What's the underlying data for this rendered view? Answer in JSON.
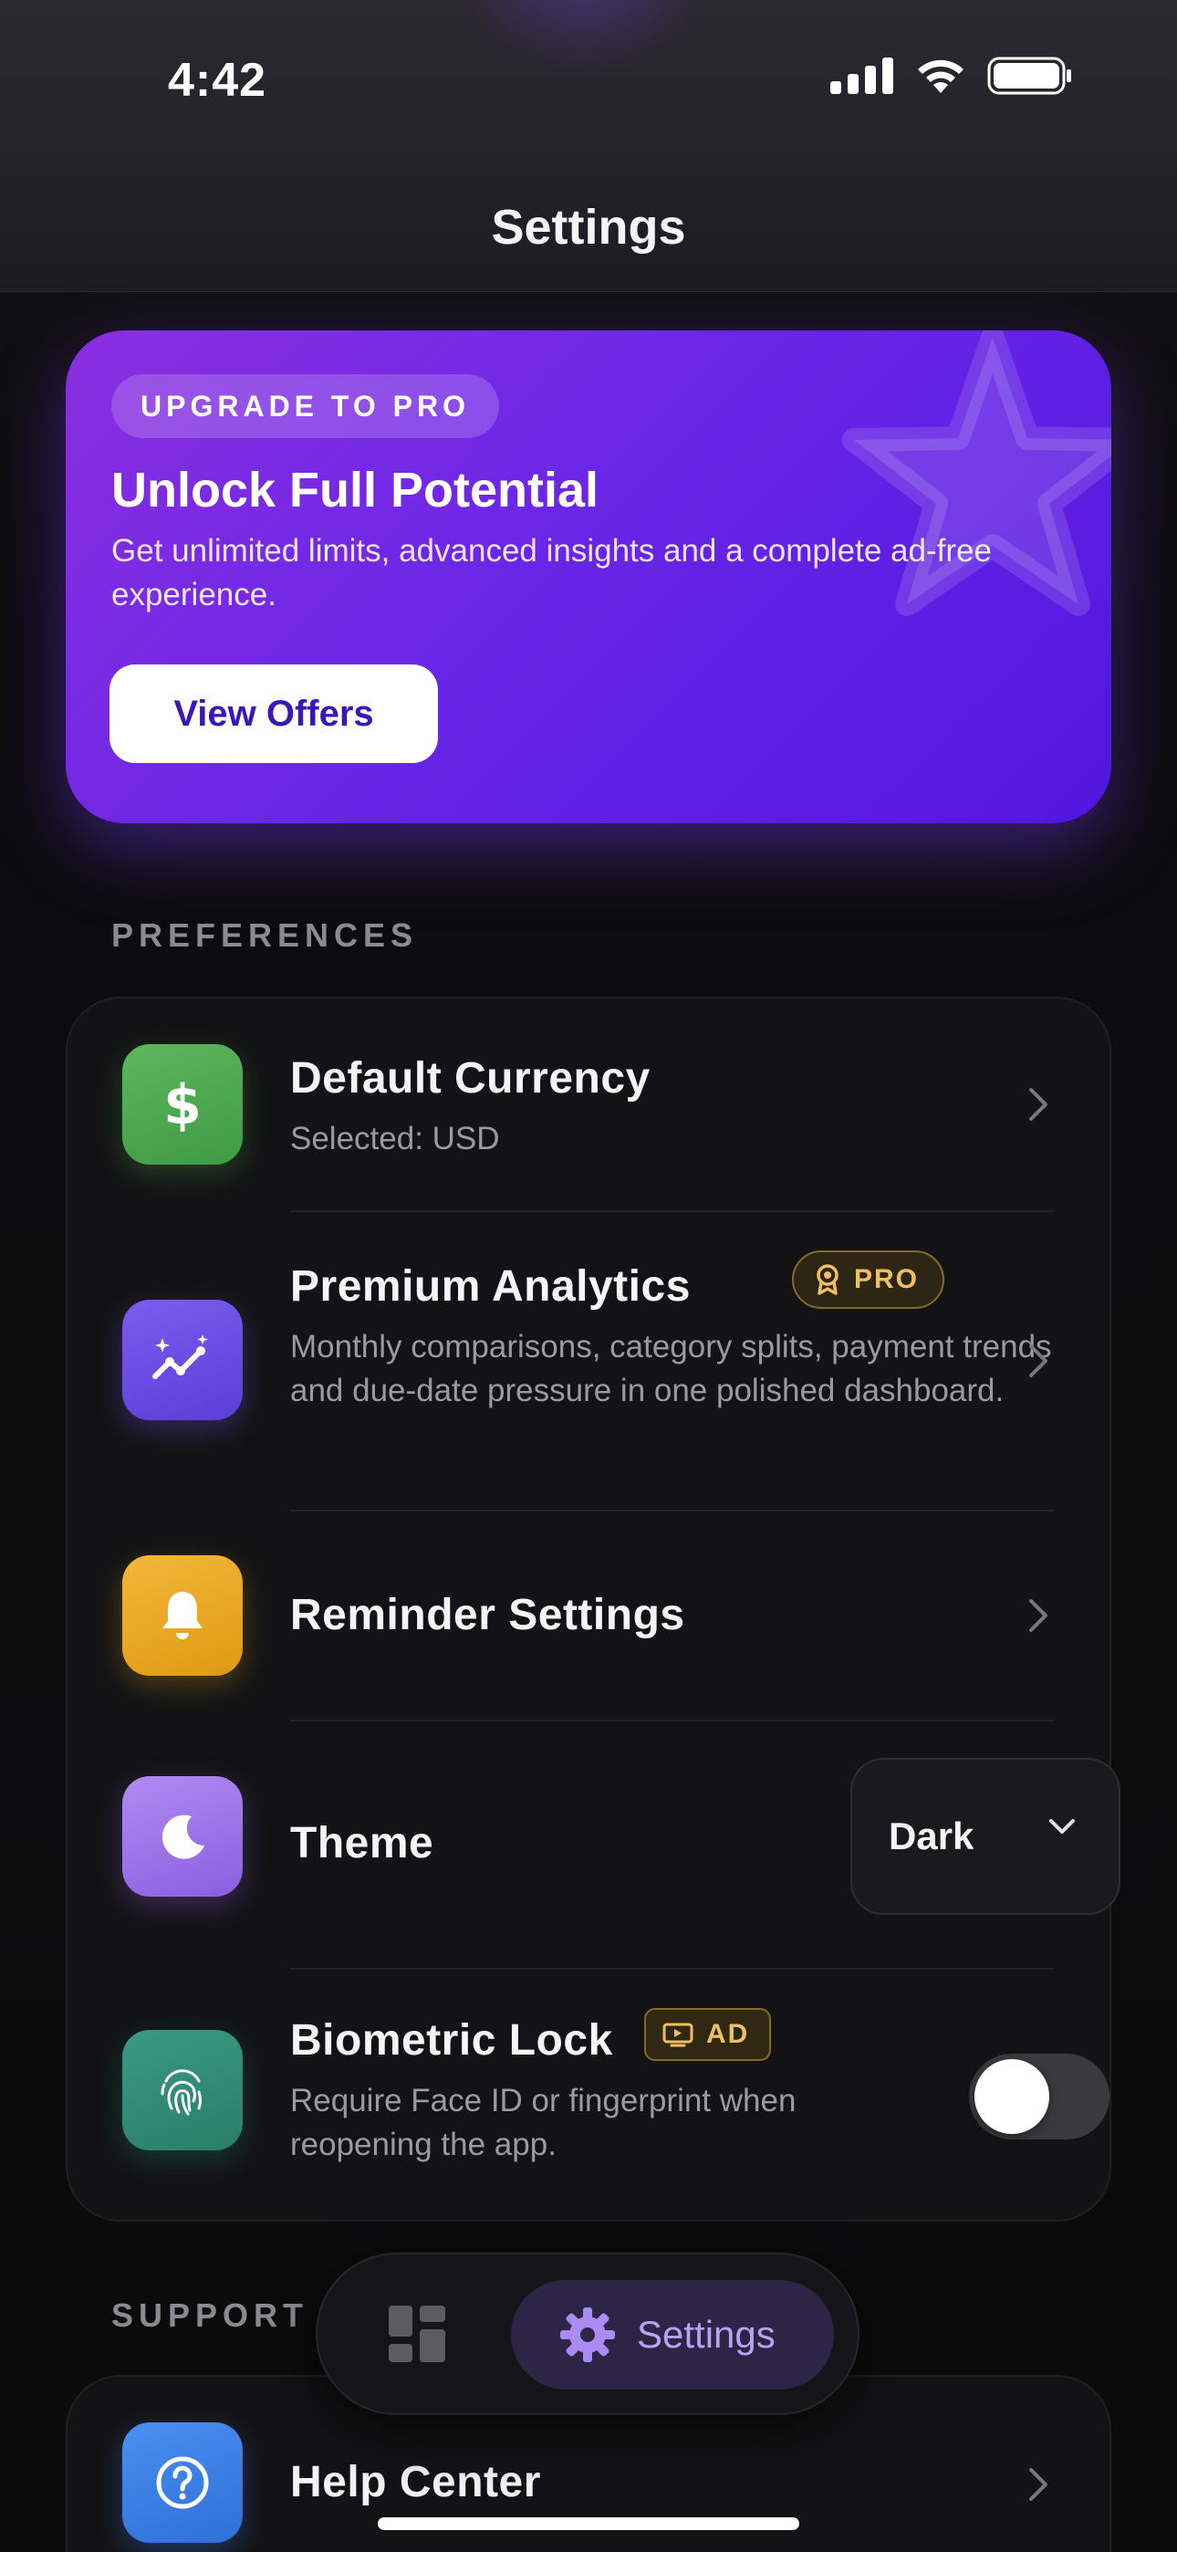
{
  "status_bar": {
    "time": "4:42"
  },
  "header": {
    "title": "Settings"
  },
  "promo": {
    "badge": "UPGRADE TO PRO",
    "title": "Unlock Full Potential",
    "description": "Get unlimited limits, advanced insights and a complete ad-free experience.",
    "button_label": "View Offers",
    "colors": {
      "start": "#8a2fe0",
      "end": "#5216e0"
    }
  },
  "preferences": {
    "section_label": "PREFERENCES",
    "items": [
      {
        "title": "Default Currency",
        "subtitle": "Selected: USD",
        "icon": "dollar-icon",
        "color": "#4ea64e"
      },
      {
        "title": "Premium Analytics",
        "badge": "PRO",
        "subtitle": "Monthly comparisons, category splits, payment trends and due-date pressure in one polished dashboard.",
        "icon": "sparkle-chart-icon",
        "color": "#6a4fe0"
      },
      {
        "title": "Reminder Settings",
        "icon": "bell-icon",
        "color": "#e8a520"
      },
      {
        "title": "Theme",
        "icon": "moon-icon",
        "color": "#9a6fe6",
        "value": "Dark"
      },
      {
        "title": "Biometric Lock",
        "badge": "AD",
        "subtitle": "Require Face ID or fingerprint when reopening the app.",
        "icon": "fingerprint-icon",
        "color": "#2e8a76",
        "enabled": false
      }
    ]
  },
  "support": {
    "section_label": "SUPPORT",
    "items": [
      {
        "title": "Help Center",
        "icon": "help-icon",
        "color": "#3f7fe0"
      }
    ]
  },
  "tabbar": {
    "tabs": [
      {
        "label": "",
        "icon": "dashboard-icon",
        "active": false
      },
      {
        "label": "Settings",
        "icon": "gear-icon",
        "active": true
      }
    ]
  }
}
